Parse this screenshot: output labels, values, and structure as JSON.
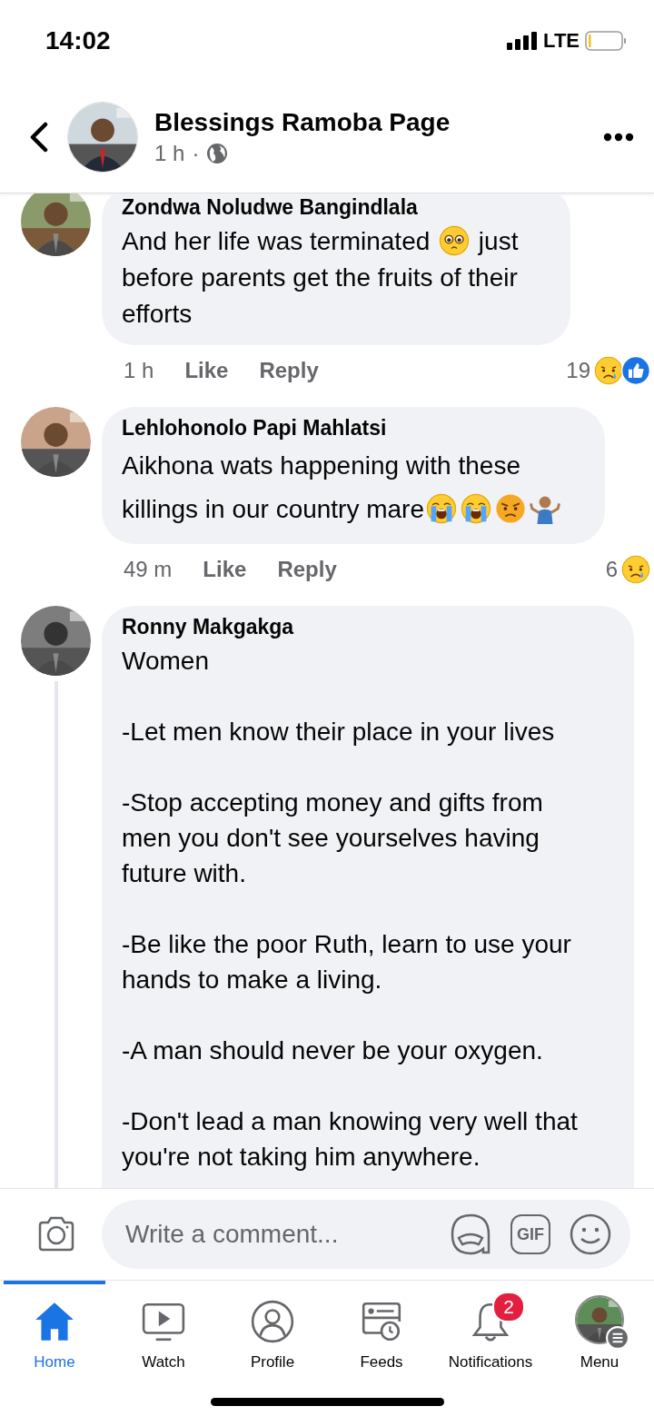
{
  "status_bar": {
    "time": "14:02",
    "network": "LTE"
  },
  "header": {
    "title": "Blessings Ramoba Page",
    "time": "1 h",
    "separator": "·"
  },
  "comments": [
    {
      "author": "Zondwa Noludwe Bangindlala",
      "body": [
        [
          {
            "kind": "text",
            "text": "And her life was terminated "
          },
          {
            "kind": "pleading"
          },
          {
            "kind": "text",
            "text": " just before parents get the fruits of their efforts"
          }
        ]
      ],
      "time": "1 h",
      "like": "Like",
      "reply": "Reply",
      "reaction_count": "19",
      "reactions": [
        {
          "kind": "sad"
        },
        {
          "kind": "like"
        }
      ],
      "thread": false
    },
    {
      "author": "Lehlohonolo Papi Mahlatsi",
      "body": [
        [
          {
            "kind": "text",
            "text": "Aikhona wats happening with these killings in our country mare"
          },
          {
            "kind": "crying"
          },
          {
            "kind": "crying"
          },
          {
            "kind": "angry"
          },
          {
            "kind": "shrug"
          }
        ]
      ],
      "time": "49 m",
      "like": "Like",
      "reply": "Reply",
      "reaction_count": "6",
      "reactions": [
        {
          "kind": "sad"
        }
      ],
      "thread": false
    },
    {
      "author": "Ronny Makgakga",
      "body": [
        [
          {
            "kind": "text",
            "text": "Women"
          }
        ],
        [
          {
            "kind": "text",
            "text": "-Let men know their place in your lives"
          }
        ],
        [
          {
            "kind": "text",
            "text": "-Stop accepting money and gifts from men you don't see yourselves having future with."
          }
        ],
        [
          {
            "kind": "text",
            "text": "-Be like the poor Ruth, learn to use your hands to make a living."
          }
        ],
        [
          {
            "kind": "text",
            "text": "-A man should never be your oxygen."
          }
        ],
        [
          {
            "kind": "text",
            "text": "-Don't lead a man knowing very well that you're not taking him anywhere."
          }
        ]
      ],
      "thread": true
    }
  ],
  "composer": {
    "placeholder": "Write a comment...",
    "gif": "GIF"
  },
  "nav": [
    {
      "label": "Home",
      "kind": "home",
      "selected": true
    },
    {
      "label": "Watch",
      "kind": "watch",
      "selected": false
    },
    {
      "label": "Profile",
      "kind": "profile",
      "selected": false
    },
    {
      "label": "Feeds",
      "kind": "feeds",
      "selected": false
    },
    {
      "label": "Notifications",
      "kind": "bell",
      "selected": false,
      "badge": "2"
    },
    {
      "label": "Menu",
      "kind": "menu",
      "selected": false
    }
  ]
}
